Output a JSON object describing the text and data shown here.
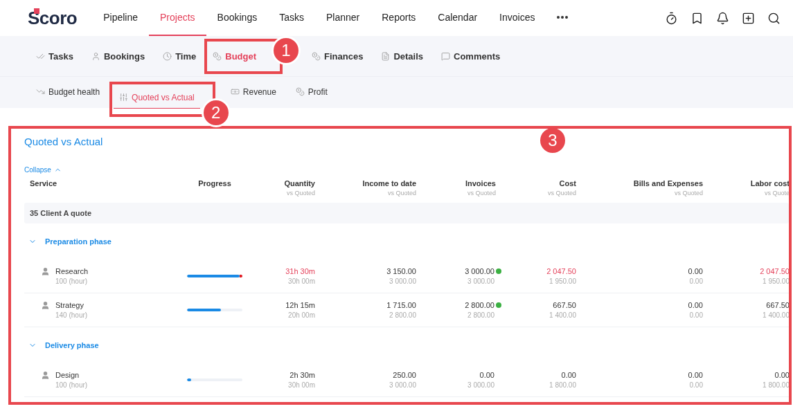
{
  "logo": {
    "text": "Scoro"
  },
  "nav": [
    {
      "label": "Pipeline",
      "selected": false
    },
    {
      "label": "Projects",
      "selected": true
    },
    {
      "label": "Bookings",
      "selected": false
    },
    {
      "label": "Tasks",
      "selected": false
    },
    {
      "label": "Planner",
      "selected": false
    },
    {
      "label": "Reports",
      "selected": false
    },
    {
      "label": "Calendar",
      "selected": false
    },
    {
      "label": "Invoices",
      "selected": false
    }
  ],
  "tabs": [
    {
      "label": "Tasks",
      "selected": false
    },
    {
      "label": "Bookings",
      "selected": false
    },
    {
      "label": "Time",
      "selected": false
    },
    {
      "label": "Budget",
      "selected": true,
      "callout": "1"
    },
    {
      "label": "Finances",
      "selected": false
    },
    {
      "label": "Details",
      "selected": false
    },
    {
      "label": "Comments",
      "selected": false
    }
  ],
  "subtabs": [
    {
      "label": "Budget health",
      "selected": false
    },
    {
      "label": "Quoted vs Actual",
      "selected": true,
      "callout": "2"
    },
    {
      "label": "Revenue",
      "selected": false
    },
    {
      "label": "Profit",
      "selected": false
    }
  ],
  "panel": {
    "title": "Quoted vs Actual",
    "callout": "3",
    "collapse": "Collapse",
    "columns": [
      {
        "label": "Service"
      },
      {
        "label": "Progress"
      },
      {
        "label": "Quantity",
        "sub": "vs Quoted"
      },
      {
        "label": "Income to date",
        "sub": "vs Quoted"
      },
      {
        "label": "Invoices",
        "sub": "vs Quoted"
      },
      {
        "label": "Cost",
        "sub": "vs Quoted"
      },
      {
        "label": "Bills and Expenses",
        "sub": "vs Quoted"
      },
      {
        "label": "Labor cost",
        "sub": "vs Quote"
      }
    ],
    "quote": "35 Client A quote",
    "phases": [
      {
        "name": "Preparation phase",
        "expanded": true,
        "rows": [
          {
            "service": "Research",
            "unit": "100 (hour)",
            "progress": {
              "level": 0.95,
              "overrun": true
            },
            "cells": [
              {
                "value": "31h 30m",
                "quoted": "30h 00m",
                "over": true
              },
              {
                "value": "3 150.00",
                "quoted": "3 000.00",
                "over": false
              },
              {
                "value": "3 000.00",
                "quoted": "3 000.00",
                "over": false,
                "status_dot": true
              },
              {
                "value": "2 047.50",
                "quoted": "1 950.00",
                "over": true
              },
              {
                "value": "0.00",
                "quoted": "0.00",
                "over": false
              },
              {
                "value": "2 047.50",
                "quoted": "1 950.00",
                "over": true
              }
            ]
          },
          {
            "service": "Strategy",
            "unit": "140 (hour)",
            "progress": {
              "level": 0.61,
              "overrun": false
            },
            "cells": [
              {
                "value": "12h 15m",
                "quoted": "20h 00m",
                "over": false
              },
              {
                "value": "1 715.00",
                "quoted": "2 800.00",
                "over": false
              },
              {
                "value": "2 800.00",
                "quoted": "2 800.00",
                "over": false,
                "status_dot": true
              },
              {
                "value": "667.50",
                "quoted": "1 400.00",
                "over": false
              },
              {
                "value": "0.00",
                "quoted": "0.00",
                "over": false
              },
              {
                "value": "667.50",
                "quoted": "1 400.00",
                "over": false
              }
            ]
          }
        ]
      },
      {
        "name": "Delivery phase",
        "expanded": true,
        "rows": [
          {
            "service": "Design",
            "unit": "100 (hour)",
            "progress": {
              "level": 0.07,
              "overrun": false
            },
            "cells": [
              {
                "value": "2h 30m",
                "quoted": "30h 00m",
                "over": false
              },
              {
                "value": "250.00",
                "quoted": "3 000.00",
                "over": false
              },
              {
                "value": "0.00",
                "quoted": "3 000.00",
                "over": false,
                "status_dot": false
              },
              {
                "value": "0.00",
                "quoted": "1 800.00",
                "over": false
              },
              {
                "value": "0.00",
                "quoted": "0.00",
                "over": false
              },
              {
                "value": "0.00",
                "quoted": "1 800.00",
                "over": false
              }
            ]
          }
        ]
      }
    ]
  }
}
